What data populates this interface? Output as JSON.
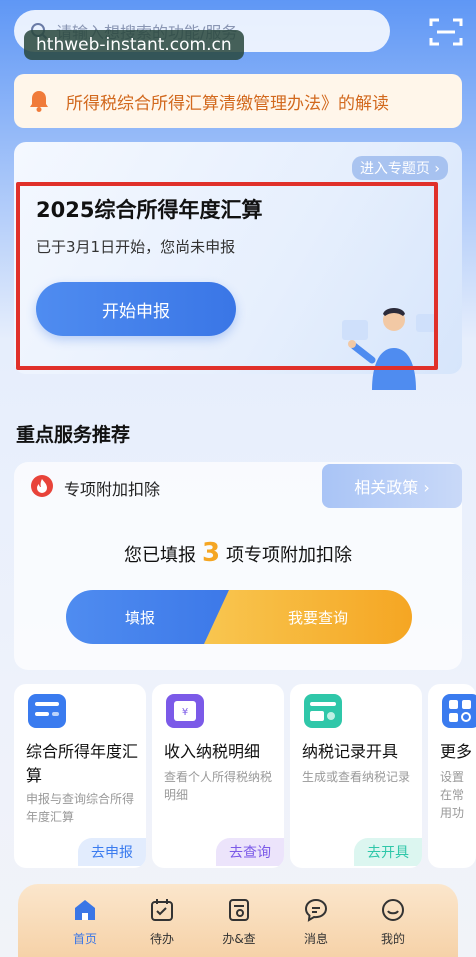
{
  "search": {
    "placeholder": "请输入想搜索的功能/服务"
  },
  "watermark": "hthweb-instant.com.cn",
  "notice": {
    "text": "所得税综合所得汇算清缴管理办法》的解读"
  },
  "banner": {
    "entry_link": "进入专题页 ›",
    "title": "2025综合所得年度汇算",
    "subtitle": "已于3月1日开始，您尚未申报",
    "start_button": "开始申报"
  },
  "section": {
    "title": "重点服务推荐"
  },
  "deduction": {
    "title": "专项附加扣除",
    "policy_button": "相关政策 ›",
    "filled_prefix": "您已填报",
    "filled_count": "3",
    "filled_suffix": "项专项附加扣除",
    "fill_button": "填报",
    "query_button": "我要查询"
  },
  "services": [
    {
      "title": "综合所得年度汇算",
      "desc": "申报与查询综合所得年度汇算",
      "tag": "去申报",
      "color": "#3a7bef"
    },
    {
      "title": "收入纳税明细",
      "desc": "查看个人所得税纳税明细",
      "tag": "去查询",
      "color": "#7b5ae8"
    },
    {
      "title": "纳税记录开具",
      "desc": "生成或查看纳税记录",
      "tag": "去开具",
      "color": "#2fc7a9"
    },
    {
      "title": "更多",
      "desc": "设置在常用功",
      "tag": "",
      "color": "#3a7bef"
    }
  ],
  "tabs": [
    {
      "label": "首页",
      "active": true
    },
    {
      "label": "待办",
      "active": false
    },
    {
      "label": "办&查",
      "active": false
    },
    {
      "label": "消息",
      "active": false
    },
    {
      "label": "我的",
      "active": false
    }
  ],
  "colors": {
    "accent": "#3a76e6",
    "highlight_border": "#e0302a",
    "number": "#f5a623"
  }
}
